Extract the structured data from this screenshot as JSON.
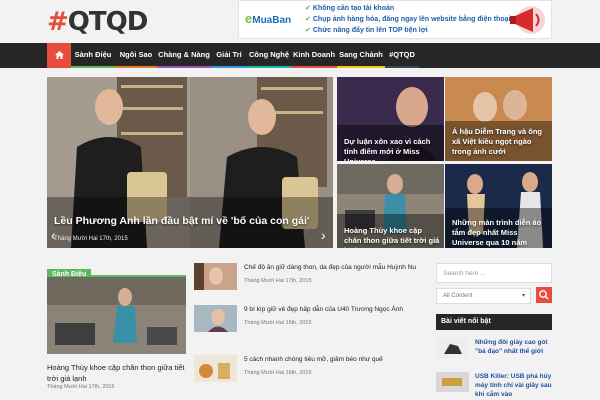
{
  "site": {
    "logo_hash": "#",
    "logo_text": "QTQD"
  },
  "ad": {
    "brand": "MuaBan",
    "brand_prefix": "e",
    "lines": [
      "Không cần tạo tài khoản",
      "Chụp ảnh hàng hóa, đăng ngay lên website bằng điện thoại",
      "Chức năng đẩy tin lên TOP tiện lợi"
    ]
  },
  "nav": {
    "items": [
      {
        "label": "Sành Điệu",
        "accent": "#5cb85c"
      },
      {
        "label": "Ngôi Sao",
        "accent": "#e67e22"
      },
      {
        "label": "Chàng & Nàng",
        "accent": "#9b59b6"
      },
      {
        "label": "Giải Trí",
        "accent": "#3498db"
      },
      {
        "label": "Công Nghệ",
        "accent": "#1abc9c"
      },
      {
        "label": "Kinh Doanh",
        "accent": "#e74c3c"
      },
      {
        "label": "Sang Chảnh",
        "accent": "#f1c40f"
      },
      {
        "label": "#QTQD",
        "accent": "#34495e"
      }
    ]
  },
  "featured": {
    "big_title": "Lều Phương Anh lần đầu bật mí về 'bố của con gái'",
    "big_date": "Tháng Mười Hai 17th, 2015",
    "tiles": [
      "Dự luận xôn xao vì cách tính điểm mới ở Miss Universe",
      "Á hậu Diễm Trang và ông xã Việt kiều ngọt ngào trong ảnh cưới",
      "Hoàng Thùy khoe cặp chân thon giữa tiết trời giá lạnh",
      "Những màn trình diễn áo tắm đẹp nhất Miss Universe qua 10 năm"
    ]
  },
  "section": {
    "label": "Sành Điệu",
    "main_title": "Hoàng Thùy khoe cặp chân thon giữa tiết trời giá lạnh",
    "main_date": "Tháng Mười Hai 17th, 2015",
    "list": [
      {
        "title": "Chế độ ăn giữ dáng thon, da đẹp của người mẫu Huỳnh Nu",
        "date": "Tháng Mười Hai 17th, 2015"
      },
      {
        "title": "9 bí kíp giữ vẻ đẹp hấp dẫn của U40 Trương Ngọc Ánh",
        "date": "Tháng Mười Hai 16th, 2015"
      },
      {
        "title": "5 cách nhanh chóng tiêu mỡ, giảm béo như quế",
        "date": "Tháng Mười Hai 16th, 2015"
      }
    ]
  },
  "sidebar": {
    "search_placeholder": "Search here ...",
    "select_value": "All Content",
    "featured_head": "Bài viết nổi bật",
    "items": [
      {
        "title": "Những đôi giày cao gót \"bá đạo\" nhất thế giới"
      },
      {
        "title": "USB Killer: USB phá hủy máy tính chỉ vài giây sau khi cắm vào"
      }
    ]
  },
  "colors": {
    "accent": "#e74c3c",
    "nav_bg": "#262626",
    "section": "#5cb85c"
  }
}
